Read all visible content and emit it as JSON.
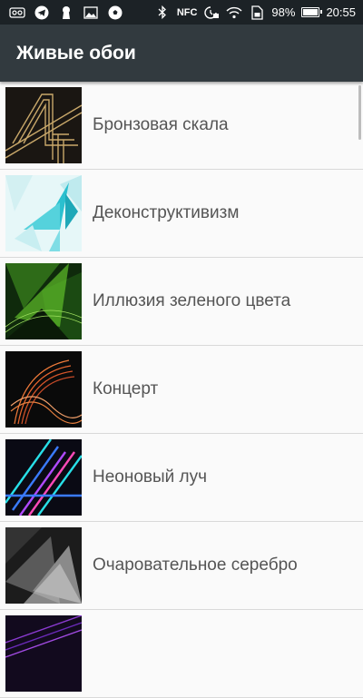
{
  "status_bar": {
    "battery_percent": "98%",
    "time": "20:55",
    "nfc_label": "NFC",
    "battery_level": 0.98,
    "icons_left": [
      "voicemail-icon",
      "telegram-icon",
      "keyhole-icon",
      "image-icon",
      "soccer-ball-icon"
    ],
    "icons_right": [
      "bluetooth-icon",
      "nfc-icon",
      "alarm-icon",
      "wifi-icon",
      "sim-icon",
      "battery-icon"
    ]
  },
  "app_bar": {
    "title": "Живые обои"
  },
  "wallpapers": [
    {
      "name": "Бронзовая скала",
      "thumb_icon": "bronze-rock-thumbnail",
      "colors": [
        "#1a1612",
        "#c9a86a"
      ]
    },
    {
      "name": "Деконструктивизм",
      "thumb_icon": "deconstructivism-thumbnail",
      "colors": [
        "#e6f7f8",
        "#2bc0cf"
      ]
    },
    {
      "name": "Иллюзия зеленого цвета",
      "thumb_icon": "green-illusion-thumbnail",
      "colors": [
        "#0f2a0c",
        "#5fbf2a"
      ]
    },
    {
      "name": "Концерт",
      "thumb_icon": "concert-thumbnail",
      "colors": [
        "#0a0a0a",
        "#f07a3a"
      ]
    },
    {
      "name": "Неоновый луч",
      "thumb_icon": "neon-ray-thumbnail",
      "colors": [
        "#0a0a14",
        "#28e0e8"
      ]
    },
    {
      "name": "Очаровательное серебро",
      "thumb_icon": "charming-silver-thumbnail",
      "colors": [
        "#1c1c1c",
        "#cfcfcf"
      ]
    },
    {
      "name": "",
      "thumb_icon": "purple-lines-thumbnail",
      "colors": [
        "#120a1e",
        "#8a3ad0"
      ]
    }
  ]
}
